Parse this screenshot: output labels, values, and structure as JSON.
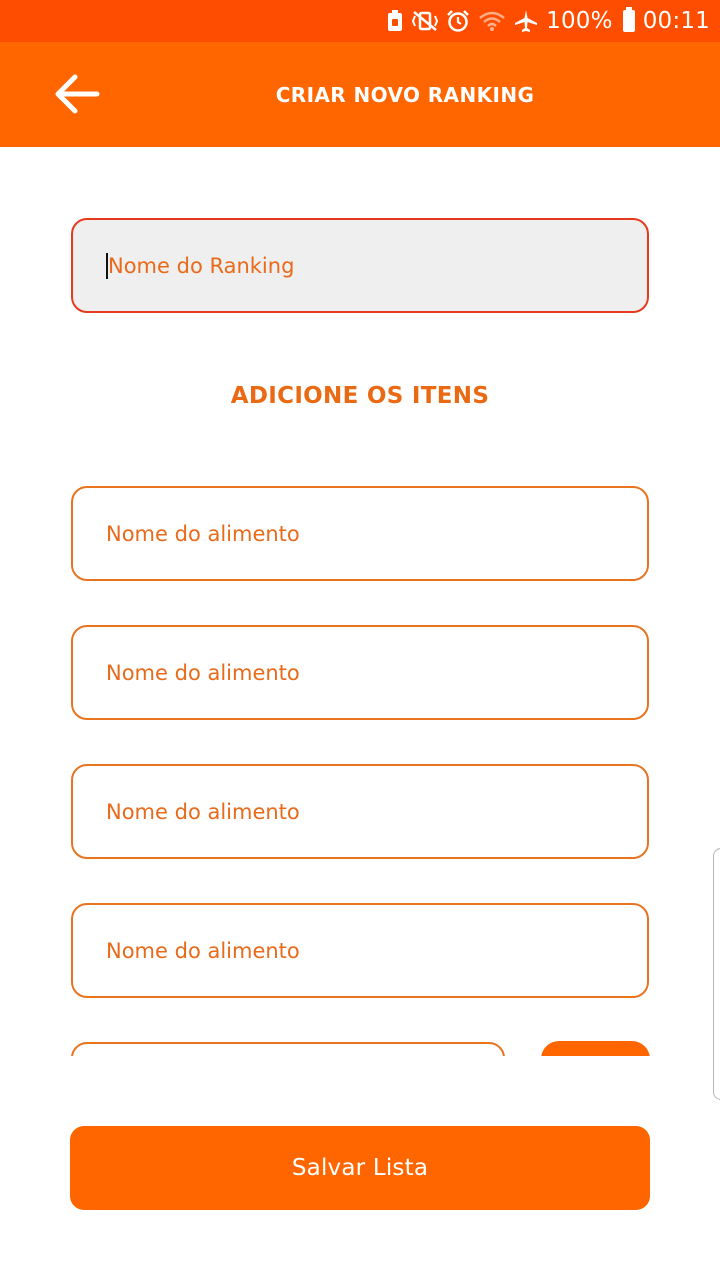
{
  "status_bar": {
    "battery_text": "100%",
    "time": "00:11",
    "icons": [
      "lock-battery-icon",
      "vibrate-off-icon",
      "alarm-icon",
      "wifi-icon",
      "airplane-icon",
      "battery-icon"
    ]
  },
  "app_bar": {
    "title": "CRIAR NOVO RANKING",
    "back_icon": "arrow-left-icon"
  },
  "ranking_name": {
    "placeholder": "Nome do Ranking",
    "value": ""
  },
  "section": {
    "title": "ADICIONE OS ITENS"
  },
  "items": [
    {
      "placeholder": "Nome do alimento",
      "value": ""
    },
    {
      "placeholder": "Nome do alimento",
      "value": ""
    },
    {
      "placeholder": "Nome do alimento",
      "value": ""
    },
    {
      "placeholder": "Nome do alimento",
      "value": ""
    }
  ],
  "actions": {
    "save_label": "Salvar Lista"
  },
  "colors": {
    "status_bar": "#ff4d00",
    "app_bar": "#ff6600",
    "accent_text": "#e86a1a",
    "error_border": "#e53a1e",
    "field_border": "#e97420",
    "button": "#ff6600"
  }
}
